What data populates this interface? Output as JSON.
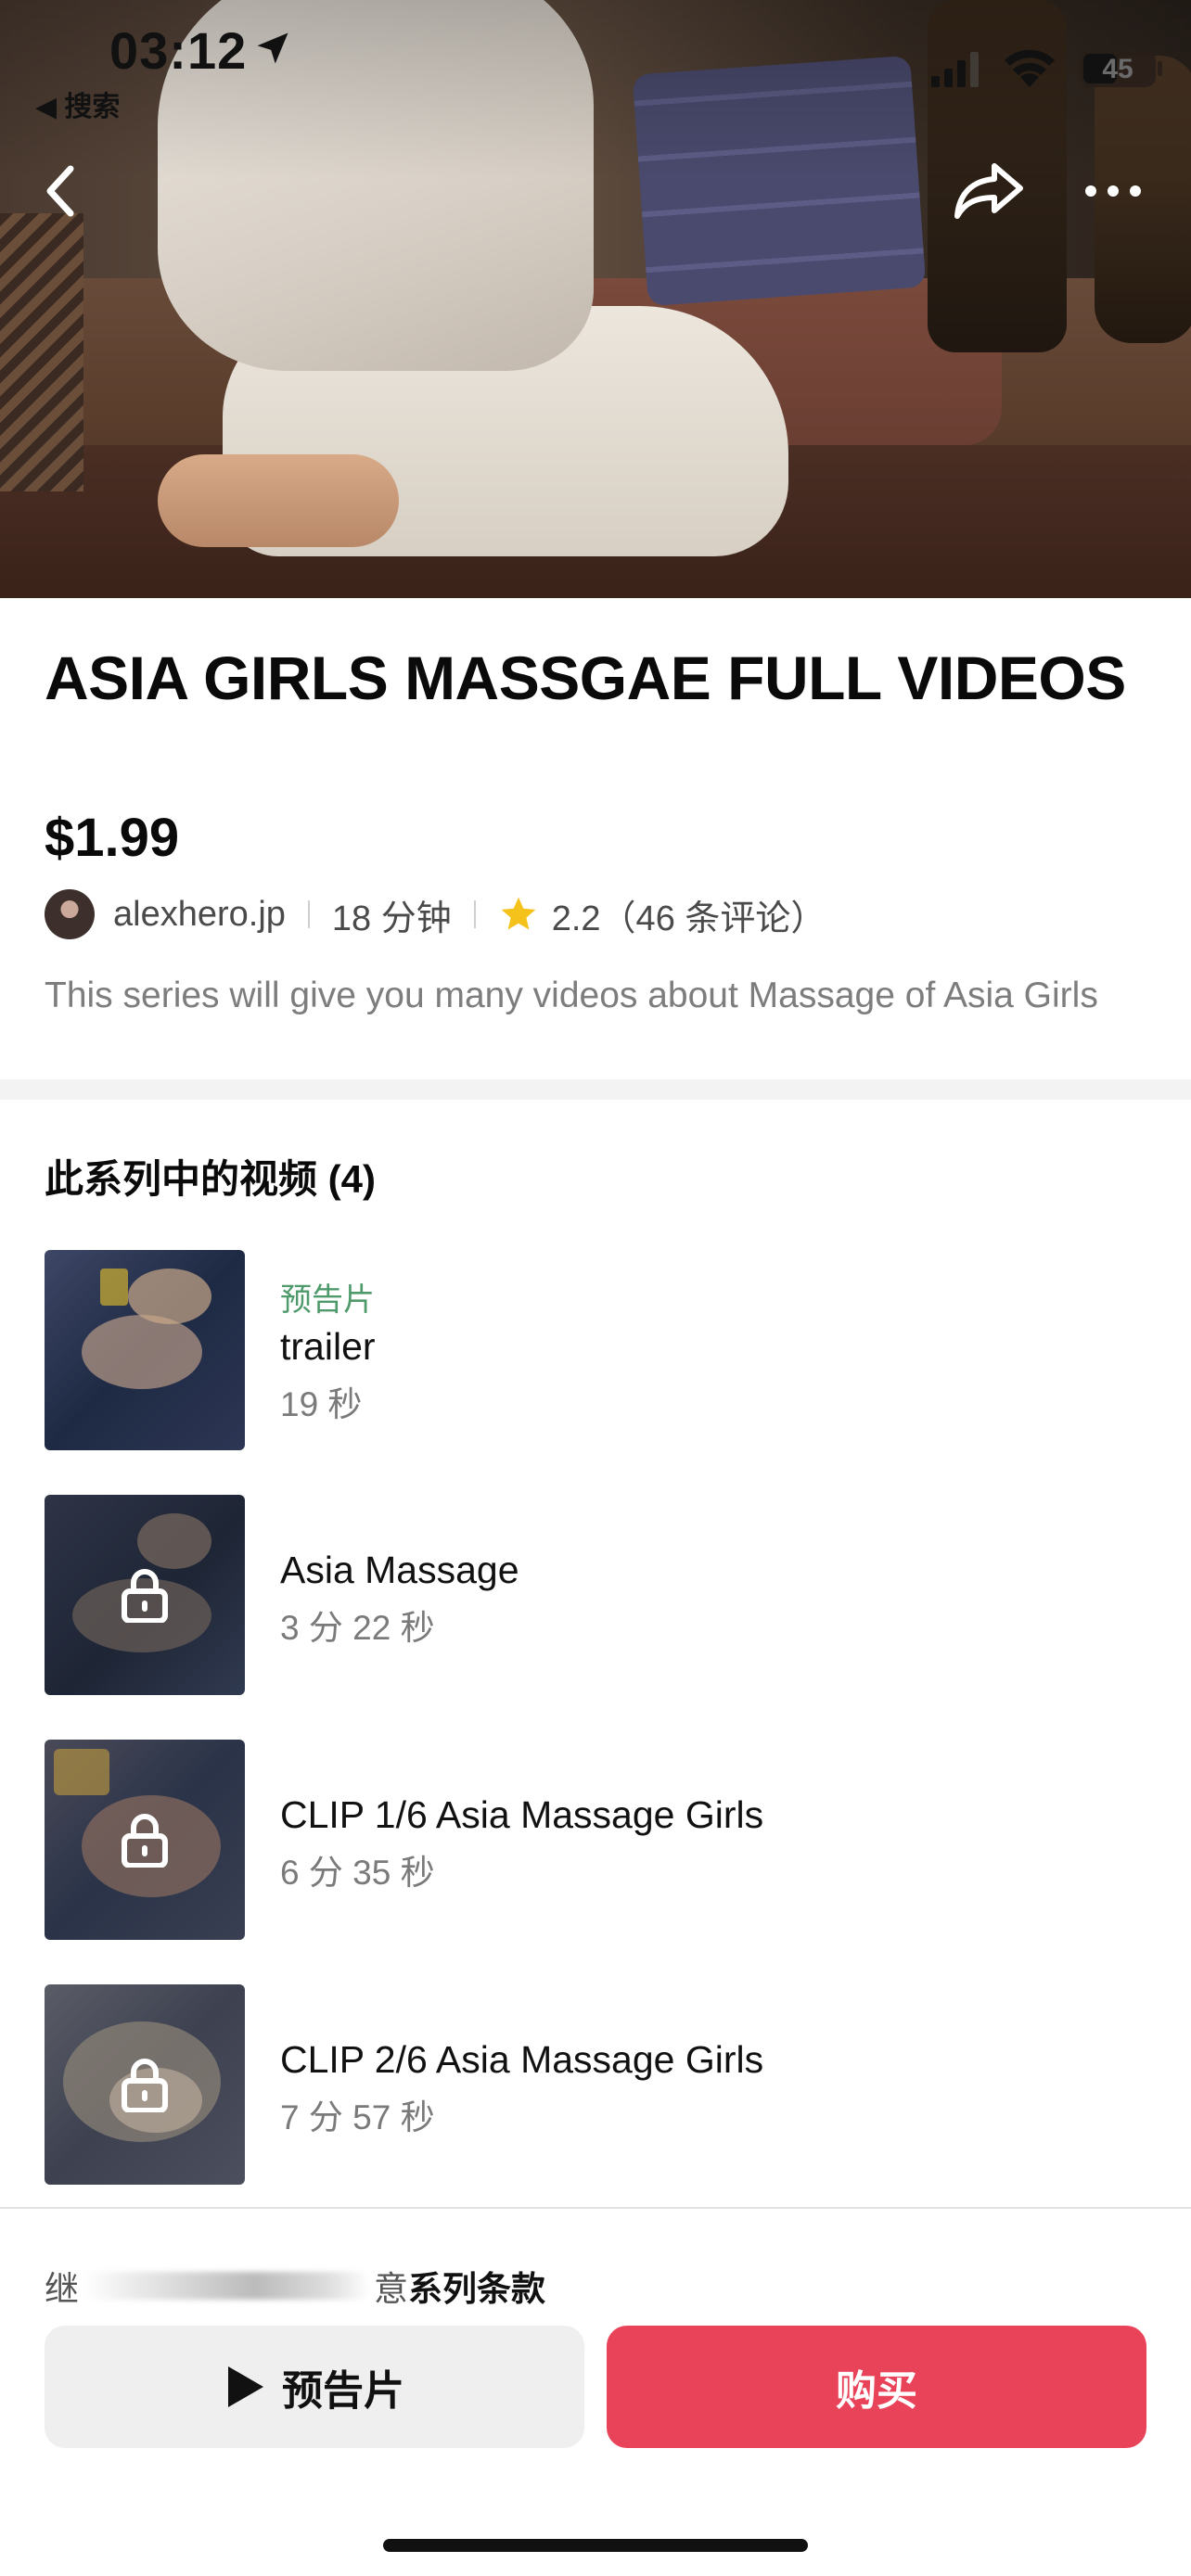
{
  "status_bar": {
    "time": "03:12",
    "back_app": "◀ 搜索",
    "battery": "45"
  },
  "product": {
    "title": "ASIA GIRLS MASSGAE FULL VIDEOS",
    "price": "$1.99",
    "creator": "alexhero.jp",
    "duration": "18 分钟",
    "rating": "2.2（46 条评论）",
    "description": "This series will give you many videos about Massage of Asia Girls"
  },
  "videos_section": {
    "title": "此系列中的视频 (4)",
    "items": [
      {
        "tag": "预告片",
        "title": "trailer",
        "duration": "19 秒",
        "locked": false
      },
      {
        "tag": "",
        "title": "Asia Massage",
        "duration": "3 分 22 秒",
        "locked": true
      },
      {
        "tag": "",
        "title": "CLIP 1/6 Asia Massage Girls",
        "duration": "6 分 35 秒",
        "locked": true
      },
      {
        "tag": "",
        "title": "CLIP 2/6 Asia Massage Girls",
        "duration": "7 分 57 秒",
        "locked": true
      }
    ]
  },
  "footer": {
    "terms_prefix": "继",
    "terms_suffix": "意",
    "terms_link": "系列条款",
    "trailer_button": "预告片",
    "buy_button": "购买"
  },
  "colors": {
    "buy": "#e9435a",
    "tag_green": "#4e9a6a",
    "star": "#f4c21a"
  },
  "icons": [
    "back-icon",
    "share-icon",
    "more-icon",
    "star-icon",
    "lock-icon",
    "play-icon",
    "location-arrow-icon",
    "signal-icon",
    "wifi-icon",
    "battery-icon"
  ]
}
